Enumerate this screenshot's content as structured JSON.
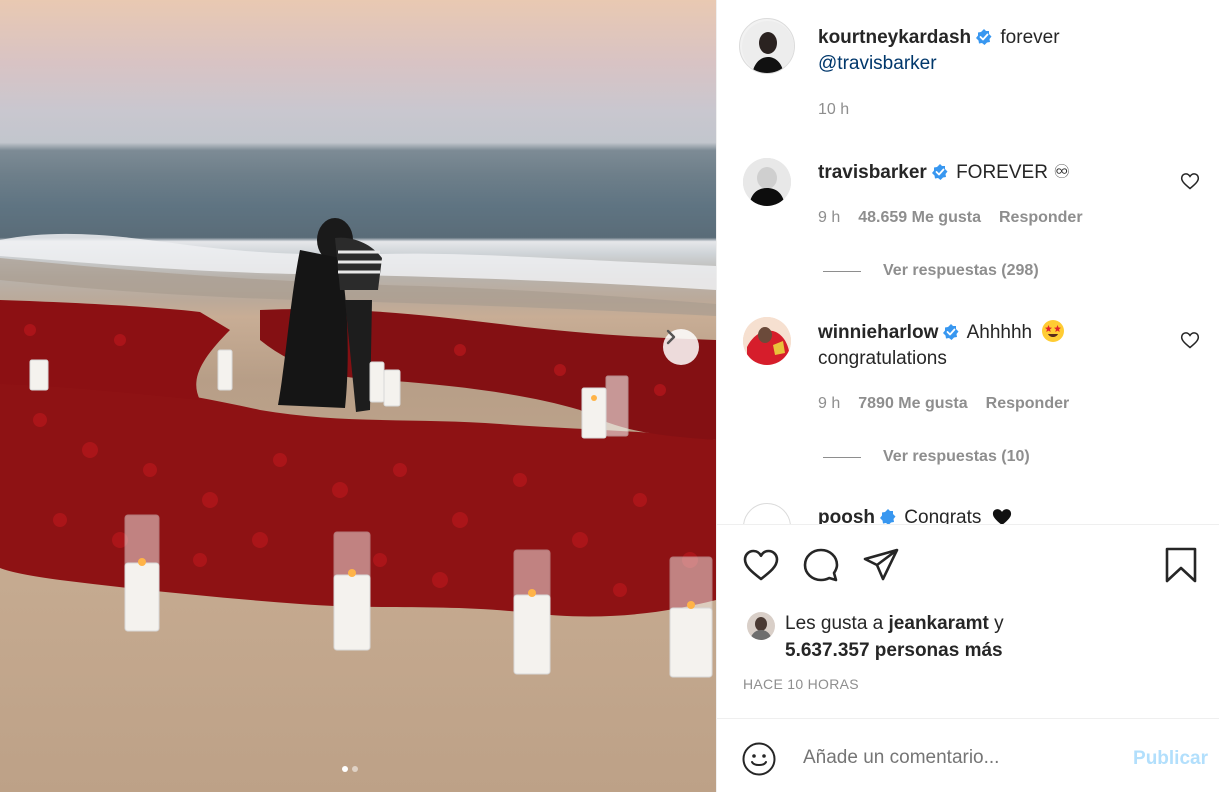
{
  "post": {
    "author": "kourtneykardash",
    "caption": "forever",
    "mention": "@travisbarker",
    "time": "10 h"
  },
  "comments": [
    {
      "username": "travisbarker",
      "text": "FOREVER ♾",
      "time": "9 h",
      "likes": "48.659 Me gusta",
      "reply": "Responder",
      "view_replies": "Ver respuestas (298)"
    },
    {
      "username": "winnieharlow",
      "text": "Ahhhhh",
      "emoji": "star-struck",
      "text2": "congratulations",
      "time": "9 h",
      "likes": "7890 Me gusta",
      "reply": "Responder",
      "view_replies": "Ver respuestas (10)"
    },
    {
      "username": "poosh",
      "text": "Congrats"
    }
  ],
  "liked_by": {
    "prefix": "Les gusta a",
    "user": "jeankaramt",
    "conj": "y",
    "others": "5.637.357 personas más"
  },
  "timestamp": "HACE 10 HORAS",
  "comment_box": {
    "placeholder": "Añade un comentario...",
    "publish": "Publicar"
  },
  "carousel": {
    "current": 1,
    "total": 2
  },
  "colors": {
    "verified": "#3897f0",
    "publish_disabled": "#b2dffc",
    "secondary_text": "#8e8e8e"
  }
}
